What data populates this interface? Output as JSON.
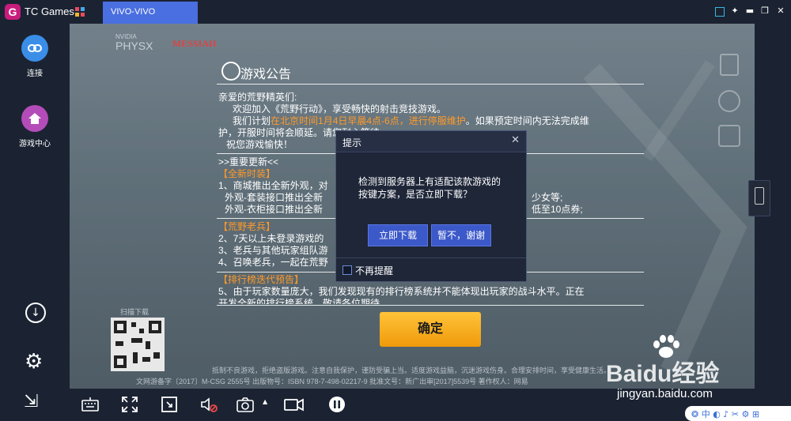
{
  "app": {
    "name": "TC Games",
    "tab": "VIVO-VIVO",
    "accent": "#4a6fe0",
    "logo_letter": "G"
  },
  "sidebar": {
    "items": [
      {
        "label": "连接",
        "icon": "link-icon",
        "color": "#3a8ee8"
      },
      {
        "label": "游戏中心",
        "icon": "home-icon",
        "color": "#b34cb8"
      }
    ]
  },
  "game": {
    "brands": {
      "physx": "PHYSX",
      "nvidia": "NVIDIA",
      "messiah": "MESSIAH"
    },
    "notice": {
      "title": "游戏公告",
      "greeting": "亲爱的荒野精英们:",
      "line1": "欢迎加入《荒野行动》，享受畅快的射击竞技游戏。",
      "line2_pre": "我们计划",
      "line2_highlight": "在北京时间1月4日早晨4点-6点，进行停服维护",
      "line2_post": "。如果预定时间内无法完成维",
      "line3": "护，开服时间将会顺延。请您耐心等待。",
      "line4": "祝您游戏愉快！",
      "updates_title": ">>重要更新<<",
      "section1": "【全新时装】",
      "s1_line1": "1、商城推出全新外观，对",
      "s1_line2": "外观-套装接口推出全新",
      "s1_line2_end": "少女等;",
      "s1_line3": "外观-衣柜接口推出全新",
      "s1_line3_end": "低至10点券;",
      "section2": "【荒野老兵】",
      "s2_line1": "2、7天以上未登录游戏的",
      "s2_line2": "3、老兵与其他玩家组队游",
      "s2_line3": "4、召唤老兵，一起在荒野",
      "section3": "【排行榜迭代预告】",
      "s3_line1": "5、由于玩家数量庞大，我们发现现有的排行榜系统并不能体现出玩家的战斗水平。正在",
      "s3_line2": "开发全新的排行榜系统，敬请各位期待。",
      "confirm": "确定"
    },
    "footer_text": "抵制不良游戏，拒绝盗版游戏。注意自我保护，谨防受骗上当。适度游戏益脑，沉迷游戏伤身。合理安排时间，享受健康生活。",
    "footer_text2": "文网游备字〔2017〕M-CSG 2555号   出版物号：ISBN 978-7-498-02217-9   批准文号：新广出审[2017]5539号   著作权人：网易",
    "qr_label": "扫描下载"
  },
  "dialog": {
    "title": "提示",
    "message": "检测到服务器上有适配该款游戏的按键方案，是否立即下载？",
    "download_btn": "立即下载",
    "later_btn": "暂不，谢谢",
    "checkbox_label": "不再提醒",
    "checkbox_checked": false
  },
  "watermark": {
    "text": "Baidu经验",
    "url": "jingyan.baidu.com"
  },
  "bottom_icons": [
    "keyboard-icon",
    "fullscreen-icon",
    "window-icon",
    "mute-icon",
    "screenshot-icon",
    "record-icon",
    "pause-icon"
  ]
}
